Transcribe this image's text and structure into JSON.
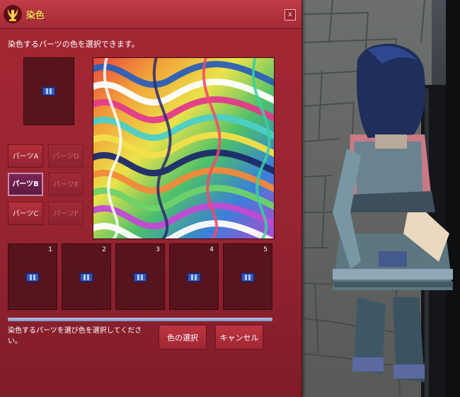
{
  "window": {
    "title": "染色",
    "close_label": "x",
    "instruction": "染色するパーツの色を選択できます。"
  },
  "parts": {
    "buttons": [
      {
        "label": "パーツA",
        "enabled": true,
        "selected": false
      },
      {
        "label": "パーツD",
        "enabled": false,
        "selected": false
      },
      {
        "label": "パーツB",
        "enabled": true,
        "selected": true
      },
      {
        "label": "パーツE",
        "enabled": false,
        "selected": false
      },
      {
        "label": "パーツC",
        "enabled": true,
        "selected": false
      },
      {
        "label": "パーツF",
        "enabled": false,
        "selected": false
      }
    ]
  },
  "slots": [
    {
      "number": "1"
    },
    {
      "number": "2"
    },
    {
      "number": "3"
    },
    {
      "number": "4"
    },
    {
      "number": "5"
    }
  ],
  "progress": {
    "value": 1.0
  },
  "footer": {
    "status": "染色するパーツを選び色を選択してください。",
    "select_color_label": "色の選択",
    "cancel_label": "キャンセル"
  },
  "colors": {
    "dialog": "#a32833",
    "title_text": "#ffd45a",
    "selected_part": "#6a1e4d",
    "progress": "#a9b9e0"
  },
  "icons": {
    "window_icon": "dye-emblem-icon",
    "slot_icon": "clothing-item-icon"
  }
}
